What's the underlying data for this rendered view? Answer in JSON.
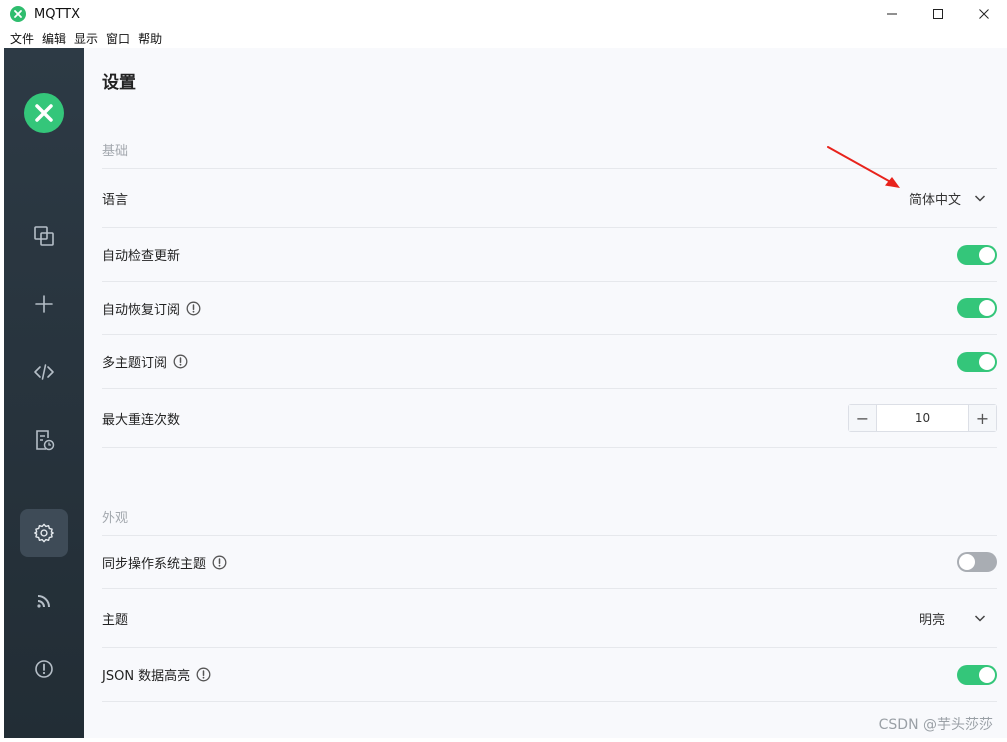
{
  "window": {
    "title": "MQTTX",
    "minimize": "—",
    "maximize": "☐",
    "close": "✕"
  },
  "menu": [
    "文件",
    "编辑",
    "显示",
    "窗口",
    "帮助"
  ],
  "sidebar": {
    "items": [
      {
        "name": "connections",
        "icon": "copy-icon"
      },
      {
        "name": "new-connection",
        "icon": "plus-icon"
      },
      {
        "name": "script",
        "icon": "code-icon"
      },
      {
        "name": "log",
        "icon": "document-clock-icon"
      },
      {
        "name": "settings",
        "icon": "gear-icon",
        "active": true
      },
      {
        "name": "benchmark",
        "icon": "rss-icon"
      },
      {
        "name": "about",
        "icon": "info-icon"
      }
    ]
  },
  "page": {
    "title": "设置",
    "basic_section": "基础",
    "appearance_section": "外观",
    "language_label": "语言",
    "language_value": "简体中文",
    "auto_check_label": "自动检查更新",
    "auto_check_on": true,
    "auto_resub_label": "自动恢复订阅",
    "auto_resub_on": true,
    "multi_topic_label": "多主题订阅",
    "multi_topic_on": true,
    "max_reconnect_label": "最大重连次数",
    "max_reconnect_value": "10",
    "max_reconnect_minus": "−",
    "max_reconnect_plus": "+",
    "sync_os_theme_label": "同步操作系统主题",
    "sync_os_theme_on": false,
    "theme_label": "主题",
    "theme_value": "明亮",
    "json_highlight_label": "JSON 数据高亮",
    "json_highlight_on": true
  },
  "watermark": "CSDN @芋头莎莎",
  "colors": {
    "accent": "#34c67a",
    "sidebar": "#2d3a45",
    "annotation_arrow": "#e8231c"
  }
}
